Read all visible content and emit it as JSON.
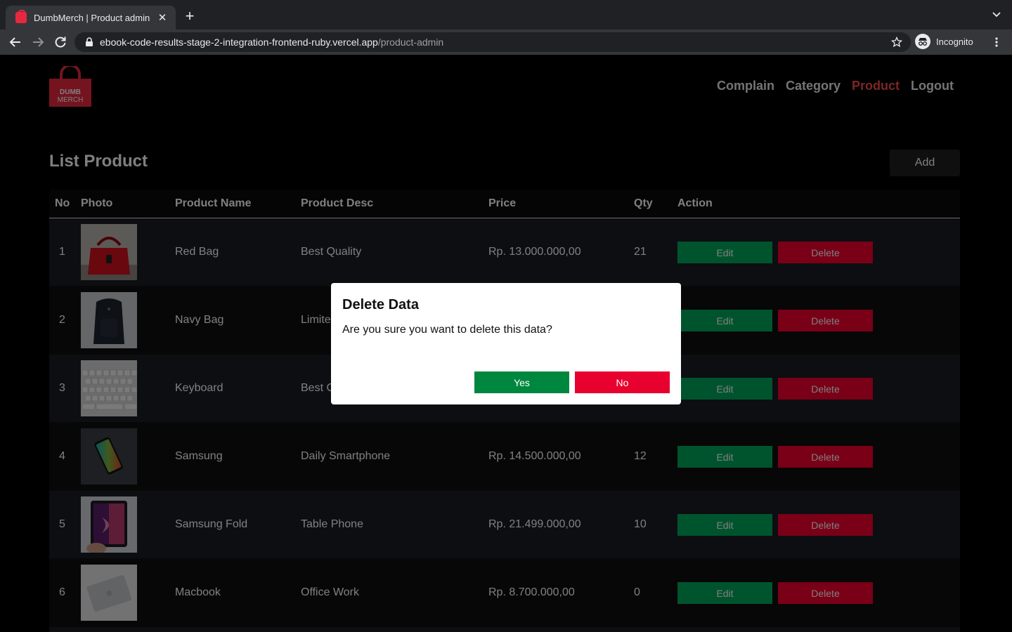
{
  "browser": {
    "tab_title": "DumbMerch | Product admin",
    "url_host": "ebook-code-results-stage-2-integration-frontend-ruby.vercel.app",
    "url_path": "/product-admin",
    "profile_label": "Incognito"
  },
  "logo": {
    "line1": "DUMB",
    "line2": "MERCH"
  },
  "nav": {
    "items": [
      {
        "label": "Complain",
        "active": false
      },
      {
        "label": "Category",
        "active": false
      },
      {
        "label": "Product",
        "active": true
      },
      {
        "label": "Logout",
        "active": false
      }
    ]
  },
  "page": {
    "title": "List Product",
    "add_label": "Add"
  },
  "table": {
    "headers": [
      "No",
      "Photo",
      "Product Name",
      "Product Desc",
      "Price",
      "Qty",
      "Action"
    ],
    "edit_label": "Edit",
    "delete_label": "Delete",
    "rows": [
      {
        "no": "1",
        "name": "Red Bag",
        "desc": "Best Quality",
        "price": "Rp. 13.000.000,00",
        "qty": "21",
        "photo": "red-bag"
      },
      {
        "no": "2",
        "name": "Navy Bag",
        "desc": "Limite",
        "price": "",
        "qty": "",
        "photo": "navy-bag"
      },
      {
        "no": "3",
        "name": "Keyboard",
        "desc": "Best C",
        "price": "",
        "qty": "",
        "photo": "keyboard"
      },
      {
        "no": "4",
        "name": "Samsung",
        "desc": "Daily Smartphone",
        "price": "Rp. 14.500.000,00",
        "qty": "12",
        "photo": "samsung"
      },
      {
        "no": "5",
        "name": "Samsung Fold",
        "desc": "Table Phone",
        "price": "Rp. 21.499.000,00",
        "qty": "10",
        "photo": "samsung-fold"
      },
      {
        "no": "6",
        "name": "Macbook",
        "desc": "Office Work",
        "price": "Rp. 8.700.000,00",
        "qty": "0",
        "photo": "macbook"
      }
    ]
  },
  "modal": {
    "title": "Delete Data",
    "message": "Are you sure you want to delete this data?",
    "yes_label": "Yes",
    "no_label": "No"
  },
  "colors": {
    "accent": "#f74d4d",
    "edit": "#00a85a",
    "delete": "#f3002e",
    "yes": "#00873f",
    "no": "#e8002e"
  }
}
